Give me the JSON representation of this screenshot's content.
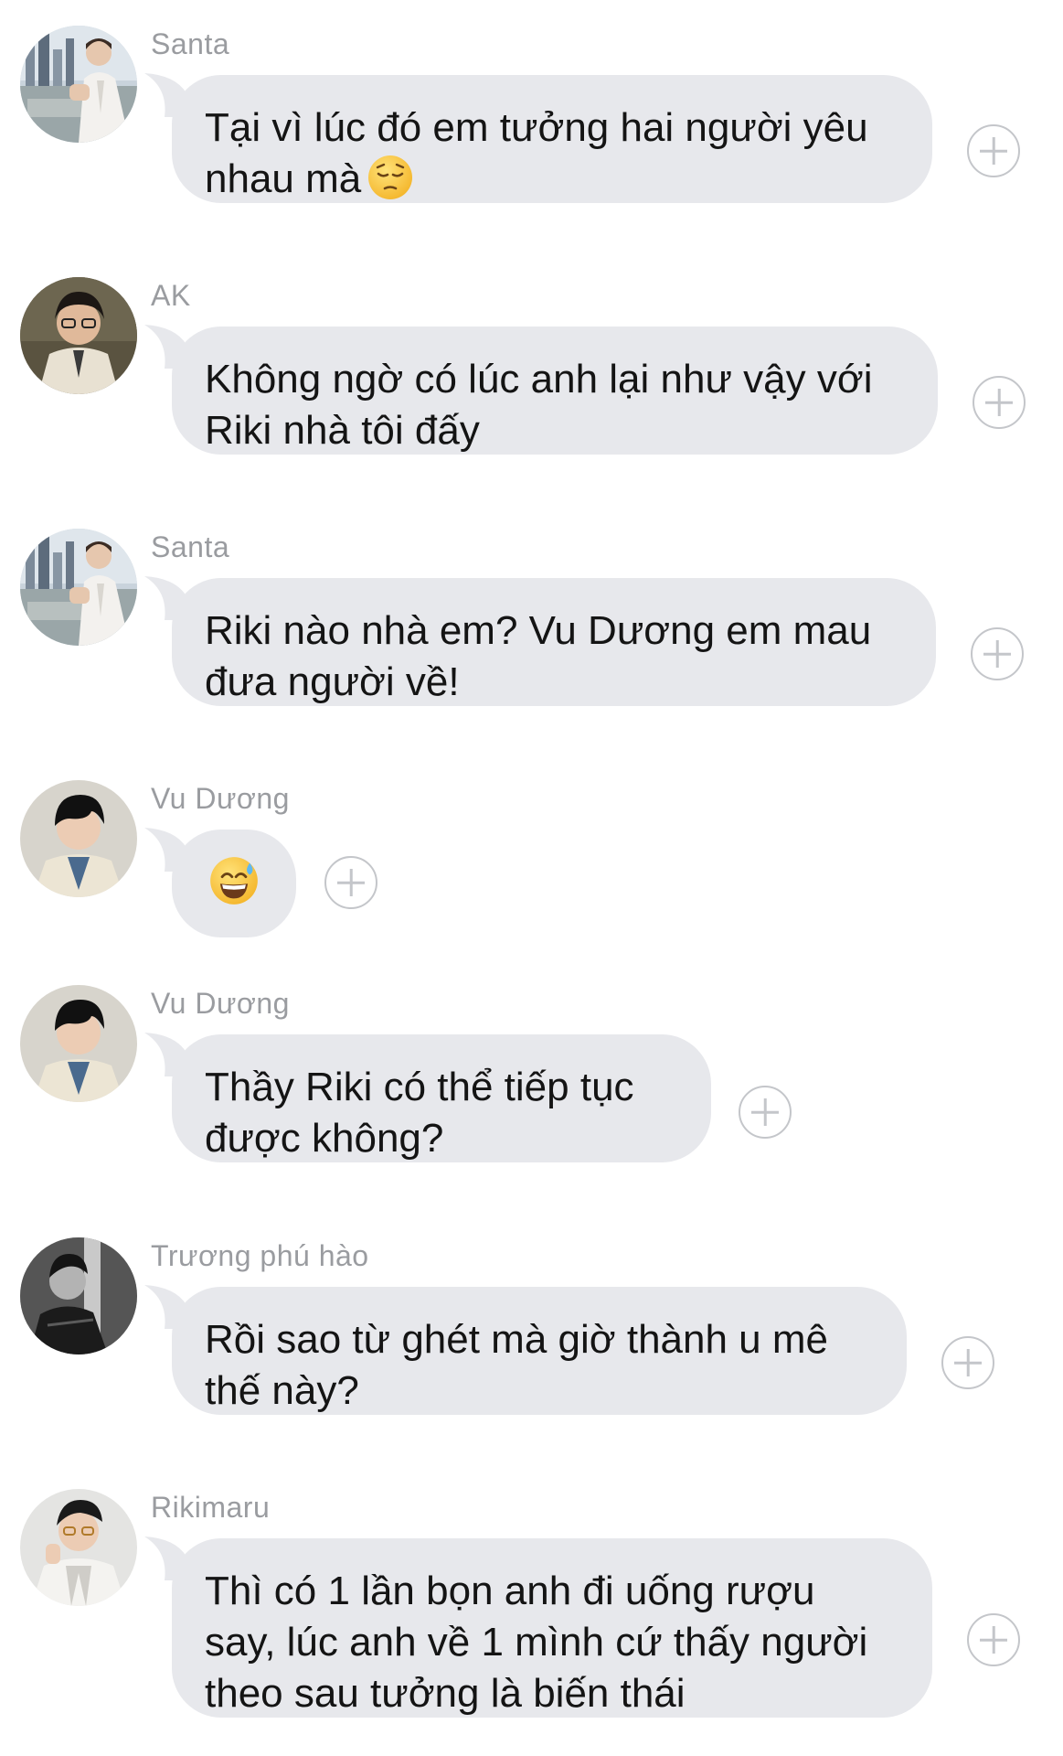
{
  "messages": [
    {
      "sender": "Santa",
      "avatar_icon": "santa-avatar-icon",
      "text": "Tại vì lúc đó em tưởng hai người yêu\nnhau mà",
      "emoji": "pensive-face-emoji"
    },
    {
      "sender": "AK",
      "avatar_icon": "ak-avatar-icon",
      "text": "Không ngờ có lúc anh lại như vậy với\nRiki nhà tôi đấy"
    },
    {
      "sender": "Santa",
      "avatar_icon": "santa-avatar-icon",
      "text": "Riki nào nhà em? Vu Dương em mau\nđưa người về!"
    },
    {
      "sender": "Vu Dương",
      "avatar_icon": "vu-duong-avatar-icon",
      "text": "",
      "emoji": "grinning-face-with-sweat-emoji"
    },
    {
      "sender": "Vu Dương",
      "avatar_icon": "vu-duong-avatar-icon",
      "text": "Thầy Riki có thể tiếp tục\nđược không?"
    },
    {
      "sender": "Trương phú hào",
      "avatar_icon": "truong-phu-hao-avatar-icon",
      "text": "Rồi sao từ ghét mà giờ thành u mê\nthế này?"
    },
    {
      "sender": "Rikimaru",
      "avatar_icon": "rikimaru-avatar-icon",
      "text": "Thì có 1 lần bọn anh đi uống rượu\nsay, lúc anh về 1 mình cứ thấy người\ntheo sau tưởng là biến thái"
    }
  ],
  "colors": {
    "bubble": "#e7e8ec",
    "sender_name": "#9a9ca0",
    "message_text": "#141414",
    "plus_icon": "#c4c6ca"
  }
}
